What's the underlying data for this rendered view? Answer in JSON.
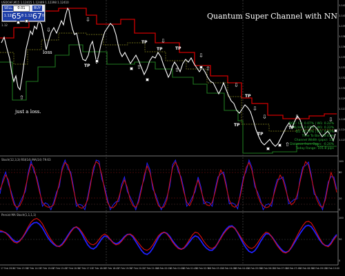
{
  "trade_panel": {
    "sell_label": "SELL",
    "buy_label": "BUY",
    "lot_value": "0.01",
    "sell_prefix": "1.12",
    "sell_big": "65",
    "sell_sup": "8",
    "buy_prefix": "1.12",
    "buy_big": "67",
    "buy_sup": "0"
  },
  "main_chart": {
    "symbol_header": "USDCHF,M15  1.12415 1.12449 1.12398 1.12410",
    "sub_header": "1.12",
    "title": "Quantum Super Channel with NN",
    "annotation_loss": "loss",
    "annotation_just_loss": "just a loss.",
    "tp_label": "TP",
    "info_lines": [
      "DOC: Ch: 0.07% | W1: 0.22%",
      "H1/H4: 0.07% | W1: 0.22%",
      "D1: 40.70% | W1: 0.22%",
      "Time To Bar: 10:41m",
      "Channel Width (pips): 1.8",
      "Distance from Open: -0.20%",
      "Today Range: 101.8 pips"
    ],
    "price_labels": [
      "1.1425",
      "1.1410",
      "1.1395",
      "1.1380",
      "1.1365",
      "1.1350",
      "1.1335",
      "1.1320",
      "1.1305",
      "1.1290",
      "1.1275",
      "1.1260",
      "1.1245",
      "1.1230"
    ]
  },
  "panel2": {
    "header": "Stoch(12,3,3) RSI(14) MA(14) 79.63",
    "levels": [
      "100",
      "80",
      "20",
      "0"
    ]
  },
  "panel3": {
    "header": "Persist MA Stoch(1,1,1,1)",
    "levels": [
      "100",
      "50",
      "0"
    ]
  },
  "time_axis": [
    "17 Feb 2016",
    "17 Feb 13:30",
    "17 Feb 14:15",
    "17 Feb 15:00",
    "17 Feb 15:45",
    "17 Feb 16:30",
    "17 Feb 17:15",
    "17 Feb 18:00",
    "17 Feb 18:45",
    "17 Feb 19:30",
    "17 Feb 20:15",
    "17 Feb 21:00",
    "18 Feb 00:15",
    "18 Feb 01:00",
    "18 Feb 01:45",
    "18 Feb 02:30",
    "18 Feb 03:15",
    "18 Feb 04:00",
    "18 Feb 04:45",
    "18 Feb 05:30",
    "18 Feb 06:15",
    "18 Feb 07:00",
    "18 Feb 07:45",
    "18 Feb 08:30",
    "18 Feb 09:15",
    "18 Feb 10:00"
  ],
  "colors": {
    "upper_channel": "#d00000",
    "lower_channel": "#1f7a1f",
    "mid_line": "#8a8a20",
    "price": "#ffffff",
    "osc_red": "#e01010",
    "osc_blue": "#2020ff",
    "grid": "#3a3a3a",
    "separator": "#9a9a9a"
  }
}
